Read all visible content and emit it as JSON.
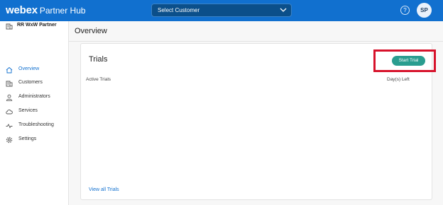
{
  "header": {
    "logo": "webex",
    "product": "Partner Hub",
    "customer_select": "Select Customer",
    "help_icon": "help-circle-icon",
    "help_glyph": "?",
    "avatar_initials": "SP",
    "bar_color": "#1170cf"
  },
  "sidebar": {
    "org_name": "RR WxW Partner",
    "items": [
      {
        "label": "Overview",
        "icon": "home-icon",
        "active": true
      },
      {
        "label": "Customers",
        "icon": "building-icon",
        "active": false
      },
      {
        "label": "Administrators",
        "icon": "person-icon",
        "active": false
      },
      {
        "label": "Services",
        "icon": "cloud-icon",
        "active": false
      },
      {
        "label": "Troubleshooting",
        "icon": "pulse-icon",
        "active": false
      },
      {
        "label": "Settings",
        "icon": "gear-icon",
        "active": false
      }
    ]
  },
  "main": {
    "title": "Overview",
    "trials_card": {
      "title": "Trials",
      "start_button": "Start Trial",
      "columns": [
        "Active Trials",
        "Day(s) Left"
      ],
      "view_all": "View all Trials"
    }
  },
  "colors": {
    "accent": "#1170cf",
    "button": "#2a9d8f",
    "highlight": "#d7122b"
  }
}
